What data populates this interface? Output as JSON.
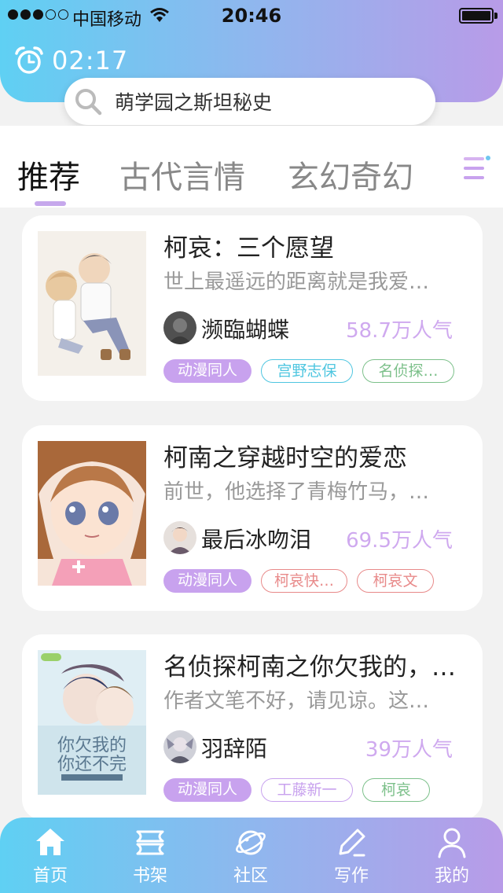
{
  "status_bar": {
    "carrier": "中国移动",
    "time": "20:46"
  },
  "alarm": {
    "time": "02:17"
  },
  "search": {
    "placeholder": "萌学园之斯坦秘史"
  },
  "tabs": [
    {
      "label": "推荐",
      "active": true
    },
    {
      "label": "古代言情",
      "active": false
    },
    {
      "label": "玄幻奇幻",
      "active": false
    }
  ],
  "books": [
    {
      "title": "柯哀：三个愿望",
      "description": "世上最遥远的距离就是我爱…",
      "author": "濒臨蝴蝶",
      "popularity": "58.7万人气",
      "tags": [
        {
          "label": "动漫同人",
          "style": "filled",
          "color": "#c8a2ee"
        },
        {
          "label": "宫野志保",
          "style": "outline",
          "color": "#4fc6e0"
        },
        {
          "label": "名侦探…",
          "style": "outline",
          "color": "#7cc08a"
        }
      ]
    },
    {
      "title": "柯南之穿越时空的爱恋",
      "description": "前世，他选择了青梅竹马，…",
      "author": "最后冰吻泪",
      "popularity": "69.5万人气",
      "tags": [
        {
          "label": "动漫同人",
          "style": "filled",
          "color": "#c8a2ee"
        },
        {
          "label": "柯哀快…",
          "style": "outline",
          "color": "#e88a8a"
        },
        {
          "label": "柯哀文",
          "style": "outline",
          "color": "#e88a8a"
        }
      ]
    },
    {
      "title": "名侦探柯南之你欠我的，…",
      "description": "作者文笔不好，请见谅。这…",
      "author": "羽辞陌",
      "popularity": "39万人气",
      "cover_text": "你欠我的，你还不完",
      "tags": [
        {
          "label": "动漫同人",
          "style": "filled",
          "color": "#c8a2ee"
        },
        {
          "label": "工藤新一",
          "style": "outline",
          "color": "#c8a2ee"
        },
        {
          "label": "柯哀",
          "style": "outline",
          "color": "#7cc08a"
        }
      ]
    }
  ],
  "bottom_nav": [
    {
      "label": "首页",
      "icon": "home-icon",
      "active": true
    },
    {
      "label": "书架",
      "icon": "bookshelf-icon",
      "active": false
    },
    {
      "label": "社区",
      "icon": "planet-icon",
      "active": false
    },
    {
      "label": "写作",
      "icon": "pencil-icon",
      "active": false
    },
    {
      "label": "我的",
      "icon": "user-icon",
      "active": false
    }
  ],
  "colors": {
    "header_gradient": [
      "#5fd0f3",
      "#b89be8"
    ],
    "accent": "#c8a2ee",
    "popularity": "#cfa9ef"
  }
}
